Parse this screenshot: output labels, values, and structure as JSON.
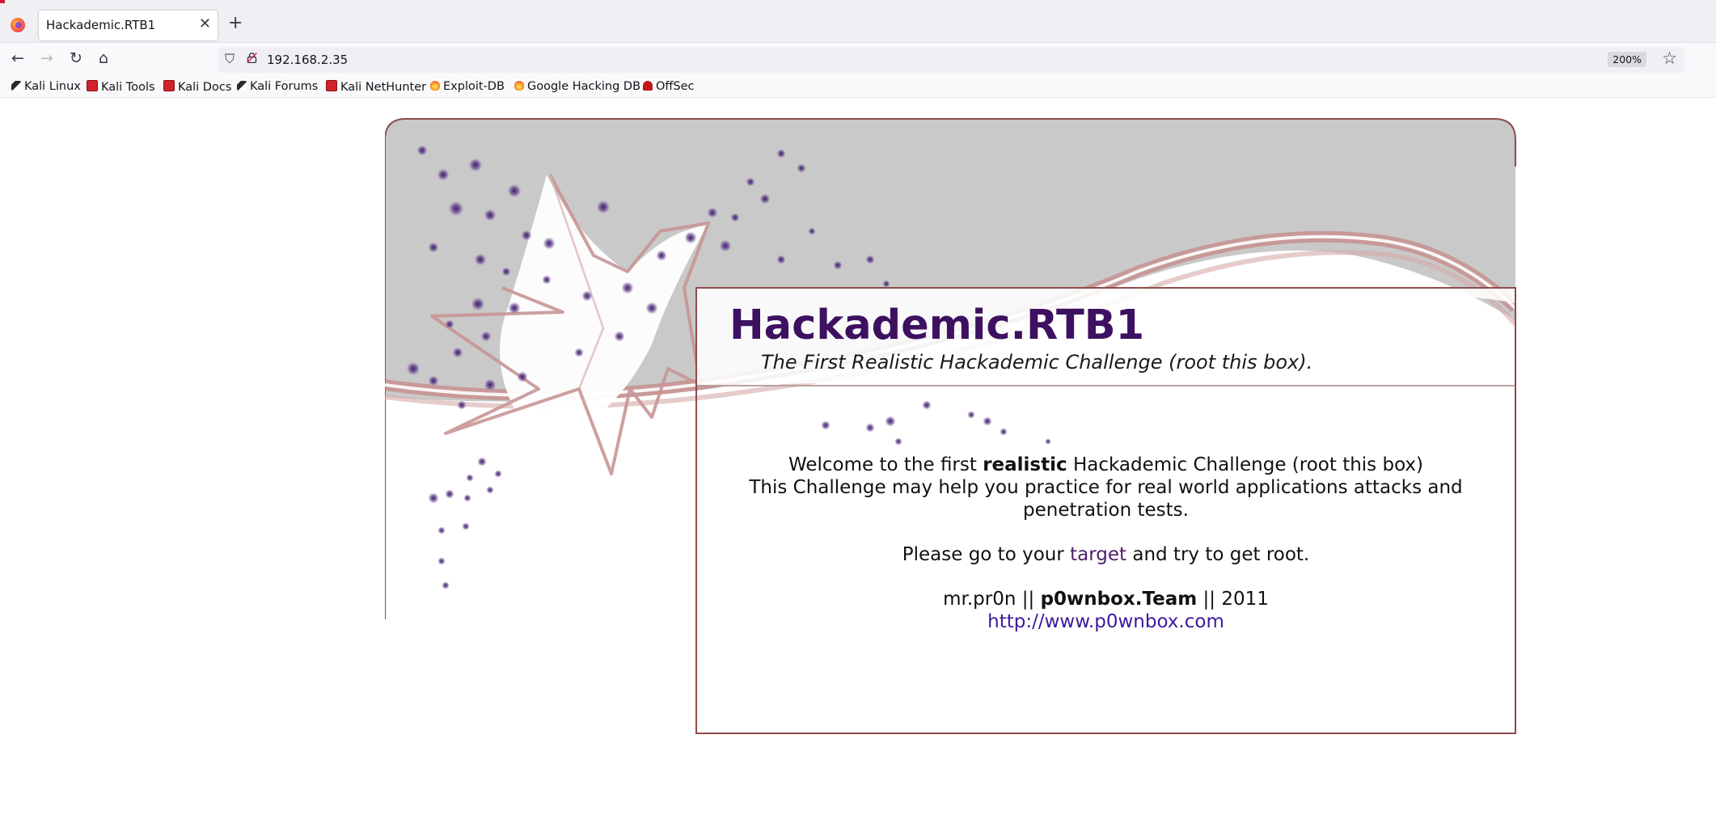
{
  "browser": {
    "tab_title": "Hackademic.RTB1",
    "tab_close": "✕",
    "new_tab": "+",
    "nav": {
      "back": "←",
      "forward": "→",
      "reload": "↻",
      "home": "⌂"
    },
    "url": "192.168.2.35",
    "zoom": "200%",
    "bookmark_star": "☆",
    "bookmarks": [
      {
        "label": "Kali Linux",
        "icon": "kali-dragon-icon"
      },
      {
        "label": "Kali Tools",
        "icon": "kali-red-icon"
      },
      {
        "label": "Kali Docs",
        "icon": "kali-red-icon"
      },
      {
        "label": "Kali Forums",
        "icon": "kali-dragon-icon"
      },
      {
        "label": "Kali NetHunter",
        "icon": "kali-red-icon"
      },
      {
        "label": "Exploit-DB",
        "icon": "exploitdb-icon"
      },
      {
        "label": "Google Hacking DB",
        "icon": "exploitdb-icon"
      },
      {
        "label": "OffSec",
        "icon": "offsec-icon"
      }
    ]
  },
  "page": {
    "title": "Hackademic.RTB1",
    "subtitle": "The First Realistic Hackademic Challenge (root this box).",
    "welcome_pre": "Welcome to the first ",
    "welcome_bold": "realistic",
    "welcome_post": " Hackademic Challenge (root this box)",
    "practice_line": "This Challenge may help you practice for real world applications attacks and penetration tests.",
    "goto_pre": "Please go to your ",
    "goto_link": "target",
    "goto_post": " and try to get root.",
    "author": "mr.pr0n || ",
    "team": "p0wnbox.Team",
    "year": " || 2011",
    "website": "http://www.p0wnbox.com"
  },
  "colors": {
    "title": "#3d1060",
    "border": "#8f4b4b",
    "header_gray": "#c9c9c9",
    "swoosh": "#c88f8f",
    "dots": "#4a2570"
  }
}
